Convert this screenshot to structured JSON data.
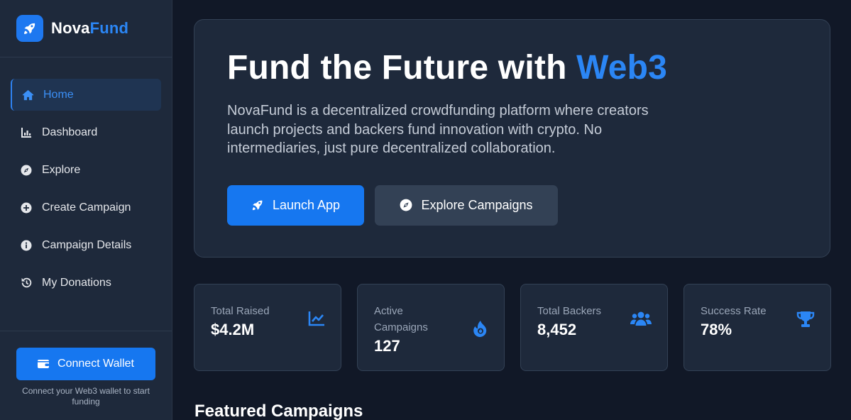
{
  "brand": {
    "name_part1": "Nova",
    "name_part2": "Fund"
  },
  "sidebar": {
    "items": [
      {
        "label": "Home",
        "icon": "home-icon",
        "active": true
      },
      {
        "label": "Dashboard",
        "icon": "chart-bar-icon"
      },
      {
        "label": "Explore",
        "icon": "compass-icon"
      },
      {
        "label": "Create Campaign",
        "icon": "plus-circle-icon"
      },
      {
        "label": "Campaign Details",
        "icon": "info-circle-icon"
      },
      {
        "label": "My Donations",
        "icon": "history-icon"
      }
    ],
    "connect_wallet_label": "Connect Wallet",
    "connect_note": "Connect your Web3 wallet to start funding"
  },
  "hero": {
    "title_prefix": "Fund the Future with ",
    "title_accent": "Web3",
    "description": "NovaFund is a decentralized crowdfunding platform where creators launch projects and backers fund innovation with crypto. No intermediaries, just pure decentralized collaboration.",
    "primary_button": "Launch App",
    "secondary_button": "Explore Campaigns"
  },
  "stats": [
    {
      "label": "Total Raised",
      "value": "$4.2M",
      "icon": "chart-line-icon"
    },
    {
      "label": "Active Campaigns",
      "value": "127",
      "icon": "fire-icon"
    },
    {
      "label": "Total Backers",
      "value": "8,452",
      "icon": "users-icon"
    },
    {
      "label": "Success Rate",
      "value": "78%",
      "icon": "trophy-icon"
    }
  ],
  "featured": {
    "title": "Featured Campaigns"
  },
  "colors": {
    "accent": "#2b86f5",
    "button": "#1677f0",
    "background": "#111827",
    "card": "#1e293b"
  }
}
